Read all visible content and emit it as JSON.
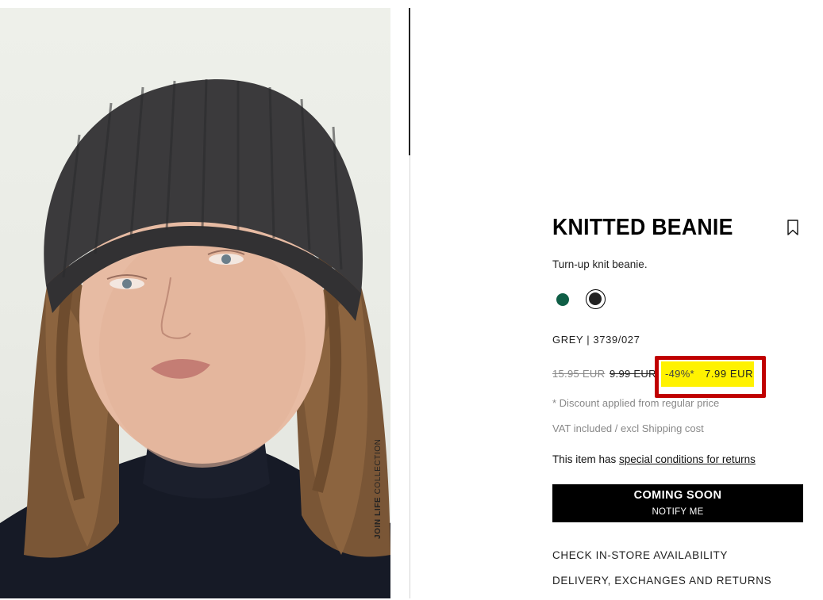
{
  "photo": {
    "caption_bold": "JOIN LIFE",
    "caption_rest": " COLLECTION"
  },
  "product": {
    "title": "KNITTED BEANIE",
    "description": "Turn-up knit beanie.",
    "colour_ref": "GREY | 3739/027",
    "swatches": [
      {
        "name": "green",
        "color": "#0f5e46",
        "selected": false
      },
      {
        "name": "black",
        "color": "#222222",
        "selected": true
      }
    ]
  },
  "price": {
    "original": "15.95 EUR",
    "previous": "9.99 EUR",
    "discount": "-49%*",
    "current": "7.99 EUR",
    "highlight_color": "#fff200",
    "annotation_color": "#c00000"
  },
  "notes": {
    "discount_note": "* Discount applied from regular price",
    "vat_note": "VAT included / excl Shipping cost",
    "returns_prefix": "This item has ",
    "returns_link": "special conditions for returns"
  },
  "cta": {
    "main": "COMING SOON",
    "sub": "NOTIFY ME"
  },
  "links": {
    "store_availability": "CHECK IN-STORE AVAILABILITY",
    "delivery": "DELIVERY, EXCHANGES AND RETURNS"
  }
}
